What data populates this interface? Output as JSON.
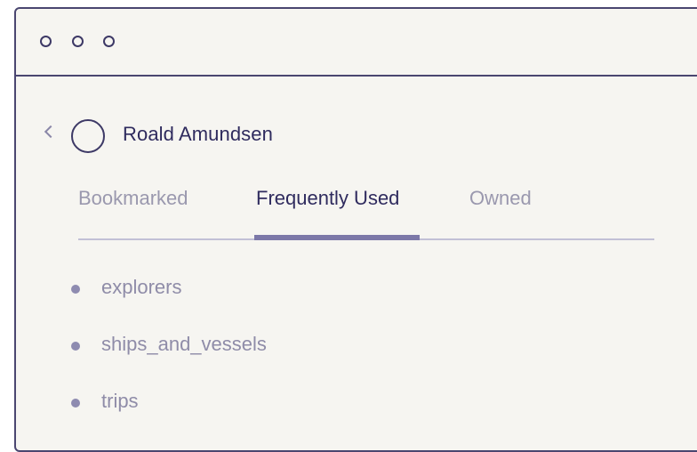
{
  "window": {
    "title_dots": [
      "close",
      "minimize",
      "maximize"
    ]
  },
  "header": {
    "back_icon": "chevron-left-icon",
    "avatar_icon": "avatar-circle",
    "user_name": "Roald Amundsen"
  },
  "tabs": [
    {
      "label": "Bookmarked",
      "active": false
    },
    {
      "label": "Frequently Used",
      "active": true
    },
    {
      "label": "Owned",
      "active": false
    }
  ],
  "list": {
    "items": [
      {
        "label": "explorers"
      },
      {
        "label": "ships_and_vessels"
      },
      {
        "label": "trips"
      }
    ]
  },
  "colors": {
    "primary_text": "#2f2b5e",
    "muted_text": "#9a98ae",
    "accent": "#7c78a8",
    "border": "#4a4670",
    "background": "#f6f5f1"
  }
}
